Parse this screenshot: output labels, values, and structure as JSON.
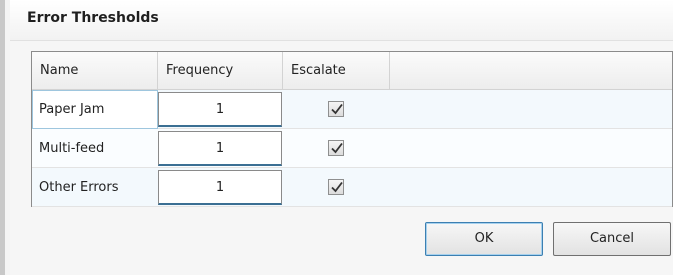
{
  "dialog": {
    "title": "Error Thresholds"
  },
  "grid": {
    "columns": {
      "name": "Name",
      "frequency": "Frequency",
      "escalate": "Escalate"
    },
    "rows": [
      {
        "name": "Paper Jam",
        "frequency": "1",
        "escalate": true,
        "selected": true
      },
      {
        "name": "Multi-feed",
        "frequency": "1",
        "escalate": true,
        "selected": false
      },
      {
        "name": "Other Errors",
        "frequency": "1",
        "escalate": true,
        "selected": false
      }
    ]
  },
  "buttons": {
    "ok": "OK",
    "cancel": "Cancel"
  },
  "icons": {
    "check": "checkmark-icon"
  }
}
